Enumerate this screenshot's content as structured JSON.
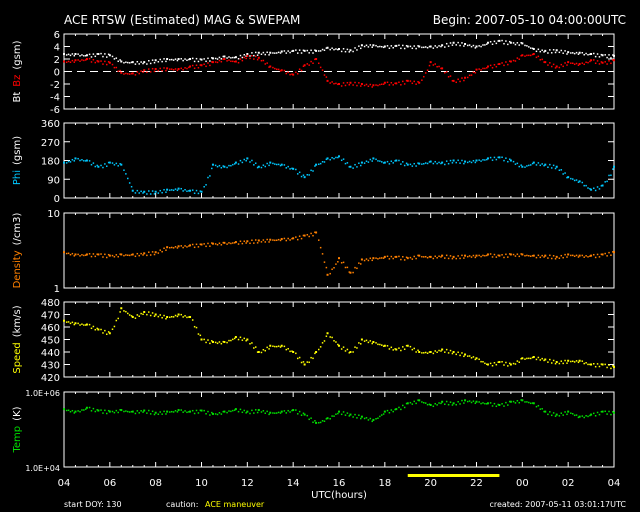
{
  "header": {
    "title": "ACE RTSW (Estimated) MAG & SWEPAM",
    "begin": "Begin: 2007-05-10 04:00:00UTC"
  },
  "footer": {
    "start_doy": "start DOY: 130",
    "caution_label": "caution:",
    "caution_text": "ACE maneuver",
    "created": "created: 2007-05-11 03:01:17UTC"
  },
  "colors": {
    "bt": "#ffffff",
    "bz": "#ff0000",
    "phi": "#00c8ff",
    "density": "#ff8000",
    "speed": "#ffff00",
    "temp": "#00e000",
    "caution": "#ffff00"
  },
  "chart_data": {
    "type": "scatter",
    "xlabel": "UTC(hours)",
    "x_ticks": [
      "04",
      "06",
      "08",
      "10",
      "12",
      "14",
      "16",
      "18",
      "20",
      "22",
      "00",
      "02",
      "04"
    ],
    "x_range_hours": [
      0,
      24
    ],
    "caution_interval_hours": [
      15,
      19
    ],
    "x": [
      0,
      0.5,
      1,
      1.5,
      2,
      2.5,
      3,
      3.5,
      4,
      4.5,
      5,
      5.5,
      6,
      6.5,
      7,
      7.5,
      8,
      8.5,
      9,
      9.5,
      10,
      10.5,
      11,
      11.5,
      12,
      12.5,
      13,
      13.5,
      14,
      14.5,
      15,
      15.5,
      16,
      16.5,
      17,
      17.5,
      18,
      18.5,
      19,
      19.5,
      20,
      20.5,
      21,
      21.5,
      22,
      22.5,
      23,
      23.5,
      24
    ],
    "panels": [
      {
        "id": "mag",
        "ylabel": [
          "Bt",
          "Bz",
          "(gsm)"
        ],
        "ylim": [
          -6,
          6
        ],
        "scale": "linear",
        "ticks": [
          "6",
          "4",
          "2",
          "0",
          "-2",
          "-4",
          "-6"
        ],
        "tick_values": [
          6,
          4,
          2,
          0,
          -2,
          -4,
          -6
        ],
        "zero_line": true,
        "series": [
          {
            "name": "Bt",
            "color_key": "bt",
            "values": [
              2.8,
              2.8,
              2.6,
              2.8,
              2.6,
              1.6,
              1.5,
              1.5,
              1.8,
              2.0,
              2.0,
              2.0,
              1.9,
              2.1,
              2.4,
              2.3,
              2.8,
              3.0,
              3.0,
              3.2,
              3.3,
              3.3,
              3.3,
              3.8,
              3.6,
              3.4,
              4.2,
              4.2,
              4.0,
              4.1,
              4.0,
              4.0,
              4.0,
              4.2,
              4.6,
              4.4,
              4.0,
              4.6,
              4.9,
              4.6,
              4.5,
              3.6,
              3.3,
              3.4,
              3.1,
              3.0,
              2.8,
              2.6,
              2.5
            ]
          },
          {
            "name": "Bz",
            "color_key": "bz",
            "values": [
              1.6,
              1.8,
              2.0,
              1.6,
              1.4,
              -0.2,
              -0.3,
              0.2,
              0.4,
              0.5,
              0.4,
              0.8,
              1.0,
              1.5,
              2.0,
              1.6,
              2.5,
              2.2,
              0.8,
              0.2,
              -0.5,
              1.0,
              2.0,
              -1.5,
              -2.0,
              -1.8,
              -2.0,
              -2.2,
              -1.8,
              -1.9,
              -1.5,
              -1.8,
              1.5,
              0.5,
              -1.5,
              -1.0,
              0.3,
              0.8,
              1.2,
              1.6,
              2.6,
              2.8,
              1.5,
              0.8,
              1.5,
              1.2,
              1.8,
              1.4,
              1.8
            ]
          }
        ]
      },
      {
        "id": "phi",
        "ylabel": [
          "Phi",
          "(gsm)"
        ],
        "ylim": [
          0,
          360
        ],
        "scale": "linear",
        "ticks": [
          "360",
          "270",
          "180",
          "90",
          "0"
        ],
        "tick_values": [
          360,
          270,
          180,
          90,
          0
        ],
        "series": [
          {
            "name": "Phi",
            "color_key": "phi",
            "values": [
              170,
              190,
              180,
              150,
              170,
              160,
              35,
              30,
              30,
              40,
              45,
              35,
              30,
              160,
              150,
              170,
              190,
              150,
              170,
              160,
              140,
              100,
              160,
              190,
              200,
              150,
              170,
              190,
              170,
              180,
              160,
              165,
              175,
              170,
              180,
              175,
              180,
              190,
              195,
              180,
              150,
              170,
              160,
              150,
              100,
              80,
              40,
              60,
              150
            ]
          }
        ]
      },
      {
        "id": "density",
        "ylabel": [
          "Density",
          "(/cm3)"
        ],
        "ylim": [
          1,
          10
        ],
        "scale": "log",
        "ticks": [
          "10",
          "1"
        ],
        "tick_values": [
          10,
          1
        ],
        "series": [
          {
            "name": "Density",
            "color_key": "density",
            "values": [
              3.0,
              2.8,
              2.8,
              2.8,
              2.7,
              2.8,
              2.8,
              2.9,
              3.0,
              3.5,
              3.6,
              3.7,
              3.8,
              3.9,
              4.0,
              4.1,
              4.2,
              4.3,
              4.4,
              4.5,
              4.6,
              5.0,
              5.5,
              1.5,
              2.5,
              1.6,
              2.4,
              2.5,
              2.6,
              2.6,
              2.5,
              2.7,
              2.6,
              2.7,
              2.6,
              2.7,
              2.7,
              2.8,
              2.7,
              2.8,
              2.8,
              2.7,
              2.7,
              2.6,
              2.8,
              2.7,
              2.7,
              2.8,
              3.0
            ]
          }
        ]
      },
      {
        "id": "speed",
        "ylabel": [
          "Speed",
          "(km/s)"
        ],
        "ylim": [
          420,
          480
        ],
        "scale": "linear",
        "ticks": [
          "480",
          "470",
          "460",
          "450",
          "440",
          "430",
          "420"
        ],
        "tick_values": [
          480,
          470,
          460,
          450,
          440,
          430,
          420
        ],
        "series": [
          {
            "name": "Speed",
            "color_key": "speed",
            "values": [
              465,
              463,
              462,
              458,
              455,
              475,
              468,
              472,
              470,
              468,
              470,
              468,
              450,
              448,
              448,
              452,
              450,
              440,
              445,
              445,
              440,
              430,
              440,
              455,
              445,
              440,
              450,
              448,
              445,
              442,
              445,
              440,
              440,
              442,
              440,
              438,
              435,
              430,
              432,
              430,
              435,
              436,
              434,
              432,
              433,
              433,
              430,
              430,
              428
            ]
          }
        ]
      },
      {
        "id": "temp",
        "ylabel": [
          "Temp",
          "(K)"
        ],
        "ylim": [
          10000,
          1000000
        ],
        "scale": "log",
        "ticks": [
          "1.0E+06",
          "1.0E+04"
        ],
        "tick_values": [
          1000000,
          10000
        ],
        "series": [
          {
            "name": "Temp",
            "color_key": "temp",
            "values": [
              350000,
              300000,
              380000,
              320000,
              300000,
              330000,
              300000,
              320000,
              280000,
              300000,
              330000,
              300000,
              320000,
              260000,
              300000,
              350000,
              300000,
              330000,
              280000,
              300000,
              330000,
              250000,
              150000,
              200000,
              300000,
              250000,
              220000,
              180000,
              300000,
              350000,
              500000,
              600000,
              450000,
              550000,
              500000,
              600000,
              550000,
              500000,
              450000,
              550000,
              600000,
              500000,
              300000,
              250000,
              300000,
              220000,
              250000,
              300000,
              280000
            ]
          }
        ]
      }
    ]
  }
}
